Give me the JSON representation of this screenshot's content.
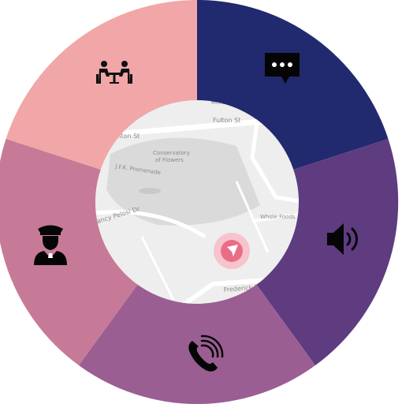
{
  "colors": {
    "meeting": "#f1a7a7",
    "chat": "#212a6e",
    "speaker": "#5f3b80",
    "call": "#9a5e93",
    "chauffeur": "#c77a98",
    "map_bg": "#eeeeee",
    "map_park": "#dadada",
    "map_road": "#ffffff",
    "locate_outer": "#f7c3cc",
    "locate_inner": "#ea6d86"
  },
  "segments": [
    {
      "id": "meeting",
      "icon": "meeting-table-icon"
    },
    {
      "id": "chat",
      "icon": "chat-bubble-icon"
    },
    {
      "id": "speaker",
      "icon": "speaker-volume-icon"
    },
    {
      "id": "call",
      "icon": "phone-call-icon"
    },
    {
      "id": "chauffeur",
      "icon": "chauffeur-icon"
    }
  ],
  "map": {
    "labels": {
      "fulton_st_left": "Fulton St",
      "fulton_st_right": "Fulton St",
      "conservatory_line1": "Conservatory",
      "conservatory_line2": "of Flowers",
      "jfk_promenade": "J.F.K. Promenade",
      "nancy_pelosi_dr": "Nancy Pelosi Dr",
      "whole_foods": "Whole Foods M",
      "frederick_st": "Frederick St",
      "top_street": "McAllis"
    }
  }
}
